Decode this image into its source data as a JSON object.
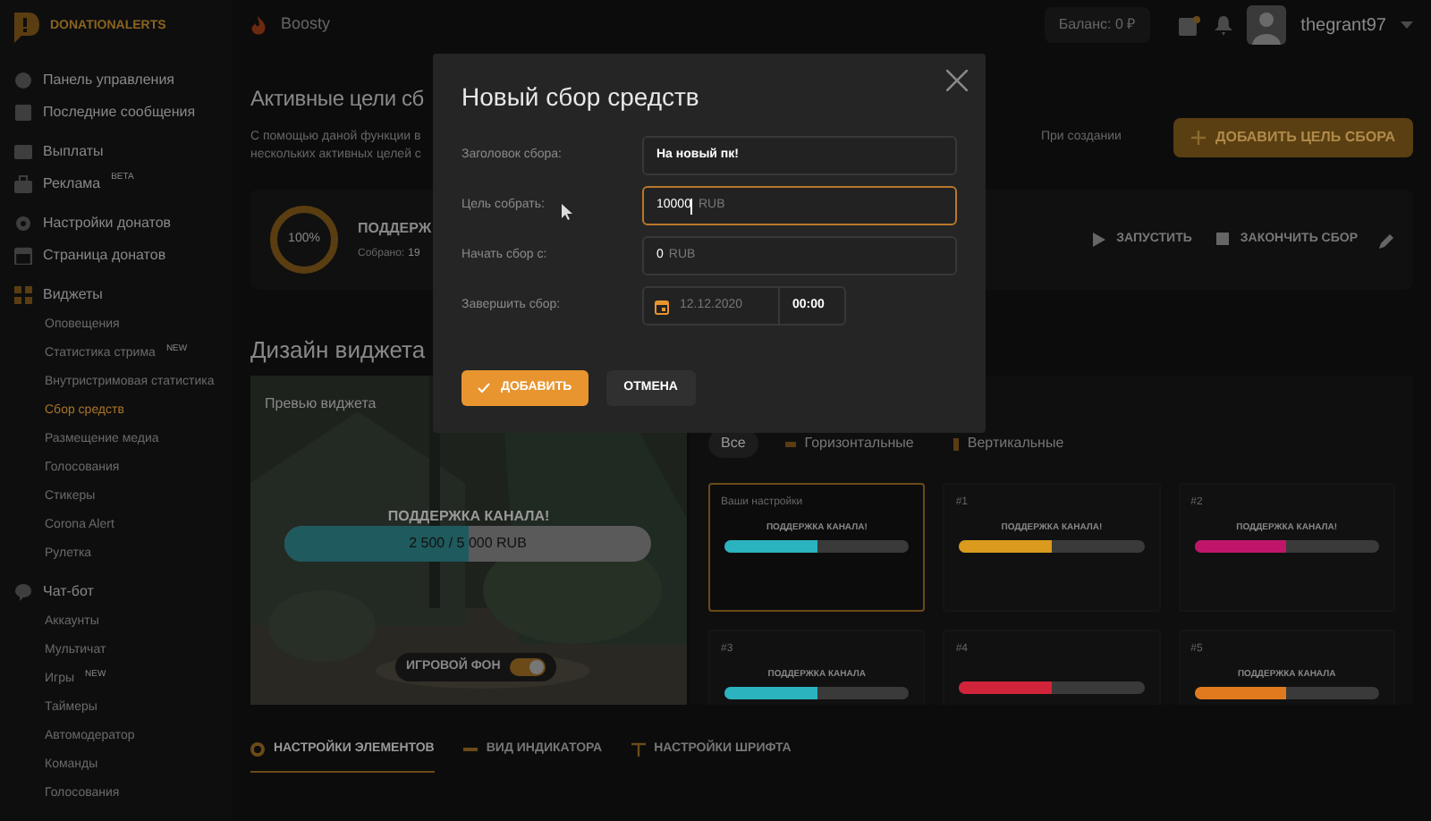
{
  "header": {
    "logo": "DONATIONALERTS",
    "boosty": "Boosty",
    "balance": "Баланс: 0 ₽",
    "username": "thegrant97"
  },
  "sidebar": {
    "groups": [
      {
        "items": [
          {
            "label": "Панель управления",
            "kind": "main",
            "selected": false
          },
          {
            "label": "Последние сообщения",
            "kind": "main",
            "selected": false
          }
        ]
      },
      {
        "items": [
          {
            "label": "Выплаты",
            "kind": "main",
            "selected": false
          },
          {
            "label": "Реклама",
            "badge": "BETA",
            "kind": "main",
            "selected": false
          }
        ]
      },
      {
        "items": [
          {
            "label": "Настройки донатов",
            "kind": "main",
            "selected": false
          },
          {
            "label": "Страница донатов",
            "kind": "main",
            "selected": false
          }
        ]
      },
      {
        "items": [
          {
            "label": "Виджеты",
            "kind": "main",
            "selected": false
          },
          {
            "label": "Оповещения",
            "kind": "sub",
            "selected": false
          },
          {
            "label": "Статистика стрима",
            "badge": "NEW",
            "kind": "sub",
            "selected": false
          },
          {
            "label": "Внутристримовая статистика",
            "kind": "sub",
            "selected": false
          },
          {
            "label": "Сбор средств",
            "kind": "sub",
            "selected": true
          },
          {
            "label": "Размещение медиа",
            "kind": "sub",
            "selected": false
          },
          {
            "label": "Голосования",
            "kind": "sub",
            "selected": false
          },
          {
            "label": "Стикеры",
            "kind": "sub",
            "selected": false
          },
          {
            "label": "Corona Alert",
            "kind": "sub",
            "selected": false
          },
          {
            "label": "Рулетка",
            "kind": "sub",
            "selected": false
          }
        ]
      },
      {
        "items": [
          {
            "label": "Чат-бот",
            "kind": "main",
            "selected": false
          },
          {
            "label": "Аккаунты",
            "kind": "sub",
            "selected": false
          },
          {
            "label": "Мультичат",
            "kind": "sub",
            "selected": false
          },
          {
            "label": "Игры",
            "badge": "NEW",
            "kind": "sub",
            "selected": false
          },
          {
            "label": "Таймеры",
            "kind": "sub",
            "selected": false
          },
          {
            "label": "Автомодератор",
            "kind": "sub",
            "selected": false
          },
          {
            "label": "Команды",
            "kind": "sub",
            "selected": false
          },
          {
            "label": "Голосования",
            "kind": "sub",
            "selected": false
          }
        ]
      }
    ]
  },
  "page": {
    "title": "Активные цели сб",
    "description_left": [
      "С помощью даной функции в",
      "нескольких активных целей с"
    ],
    "description_right": "При создании",
    "add_button": "ДОБАВИТЬ ЦЕЛЬ СБОРА"
  },
  "goal_card": {
    "percent": "100%",
    "level": 1,
    "title": "ПОДДЕРЖ",
    "collected_label": "Собрано:",
    "collected_value": "19",
    "actions": [
      "ЗАПУСТИТЬ",
      "ЗАКОНЧИТЬ СБОР"
    ]
  },
  "design": {
    "title": "Дизайн виджета",
    "preview": {
      "label": "Превью виджета",
      "caption": "ПОДДЕРЖКА КАНАЛА!",
      "bar_text": "2 500 / 5 000 RUB",
      "level": 0.5,
      "toggle": {
        "label": "ИГРОВОЙ ФОН",
        "on": true
      }
    },
    "filters": [
      {
        "label": "Все",
        "selected": true
      },
      {
        "label": "Горизонтальные",
        "selected": false
      },
      {
        "label": "Вертикальные",
        "selected": false
      }
    ],
    "presets": [
      {
        "label": "Ваши настройки",
        "caption": "ПОДДЕРЖКА КАНАЛА!",
        "level": 0.5,
        "color": "#2bb3c0",
        "selected": true
      },
      {
        "label": "#1",
        "caption": "ПОДДЕРЖКА КАНАЛА!",
        "level": 0.5,
        "color": "#d99a1e",
        "selected": false
      },
      {
        "label": "#2",
        "caption": "ПОДДЕРЖКА КАНАЛА!",
        "level": 0.5,
        "color": "#c0166a",
        "selected": false
      },
      {
        "label": "#3",
        "caption": "ПОДДЕРЖКА КАНАЛА",
        "level": 0.5,
        "color": "#2bb3c0",
        "selected": false
      },
      {
        "label": "#4",
        "level": 0.5,
        "color": "#d0243a",
        "selected": false
      },
      {
        "label": "#5",
        "caption": "ПОДДЕРЖКА КАНАЛА",
        "level": 0.5,
        "color": "#e07a1e",
        "selected": false
      }
    ]
  },
  "tabs": [
    {
      "label": "НАСТРОЙКИ ЭЛЕМЕНТОВ",
      "selected": true
    },
    {
      "label": "ВИД ИНДИКАТОРА",
      "selected": false
    },
    {
      "label": "НАСТРОЙКИ ШРИФТА",
      "selected": false
    }
  ],
  "modal": {
    "title": "Новый сбор средств",
    "fields": [
      {
        "label": "Заголовок сбора:",
        "kind": "text",
        "value": "На новый пк!",
        "focused": false
      },
      {
        "label": "Цель собрать:",
        "kind": "money",
        "value": "10000",
        "unit": "RUB",
        "focused": true
      },
      {
        "label": "Начать сбор с:",
        "kind": "money",
        "value": "0",
        "unit": "RUB",
        "focused": false
      },
      {
        "label": "Завершить сбор:",
        "kind": "datetime",
        "date": "12.12.2020",
        "time": "00:00",
        "focused": false
      }
    ],
    "confirm": "ДОБАВИТЬ",
    "cancel": "ОТМЕНА"
  }
}
